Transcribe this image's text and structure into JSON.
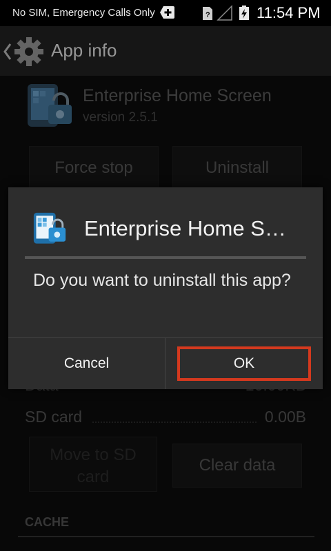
{
  "status_bar": {
    "carrier_text": "No SIM, Emergency Calls Only",
    "time": "11:54 PM",
    "icons": [
      "plus-icon",
      "no-sim-icon",
      "signal-icon",
      "battery-charging-icon"
    ]
  },
  "action_bar": {
    "title": "App info",
    "icons": [
      "back-chevron-icon",
      "settings-gear-icon"
    ]
  },
  "app": {
    "name": "Enterprise Home Screen",
    "version": "version 2.5.1",
    "icon": "enterprise-lock-app-icon"
  },
  "buttons": {
    "force_stop": "Force stop",
    "uninstall": "Uninstall",
    "move_to_sd_line1": "Move to SD",
    "move_to_sd_line2": "card",
    "clear_data": "Clear data"
  },
  "storage": {
    "data_label": "Data",
    "data_value": "16.00KB",
    "sd_card_label": "SD card",
    "sd_card_value": "0.00B"
  },
  "sections": {
    "cache": "CACHE"
  },
  "dialog": {
    "title": "Enterprise Home S…",
    "message": "Do you want to uninstall this app?",
    "cancel_label": "Cancel",
    "ok_label": "OK",
    "highlight_color": "#d4391e"
  }
}
